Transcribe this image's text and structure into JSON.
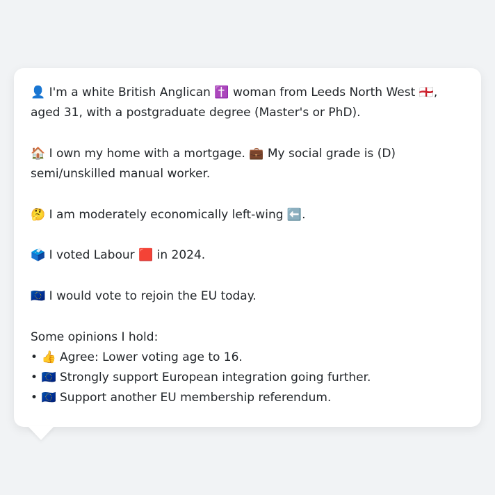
{
  "profile": {
    "identity": {
      "icon": "👤",
      "text_1": " I'm a white British Anglican ",
      "icon_religion": "✝️",
      "text_2": " woman from Leeds North West ",
      "icon_flag": "🏴󠁧󠁢󠁥󠁮󠁧󠁿",
      "text_3": ", aged 31, with a postgraduate degree (Master's or PhD)."
    },
    "housing": {
      "icon": "🏠",
      "text_1": " I own my home with a mortgage. ",
      "icon_work": "💼",
      "text_2": " My social grade is (D) semi/unskilled manual worker."
    },
    "economics": {
      "icon": "🤔",
      "text_1": " I am moderately economically left-wing ",
      "icon_dir": "⬅️",
      "text_2": "."
    },
    "vote": {
      "icon": "🗳️",
      "text_1": " I voted Labour ",
      "icon_party": "🟥",
      "text_2": " in 2024."
    },
    "eu": {
      "icon": "🇪🇺",
      "text": " I would vote to rejoin the EU today."
    },
    "opinions": {
      "heading": "Some opinions I hold:",
      "items": [
        {
          "bullet": "• ",
          "icon": "👍",
          "text": " Agree: Lower voting age to 16."
        },
        {
          "bullet": "• ",
          "icon": "🇪🇺",
          "text": " Strongly support European integration going further."
        },
        {
          "bullet": "• ",
          "icon": "🇪🇺",
          "text": " Support another EU membership referendum."
        }
      ]
    }
  }
}
